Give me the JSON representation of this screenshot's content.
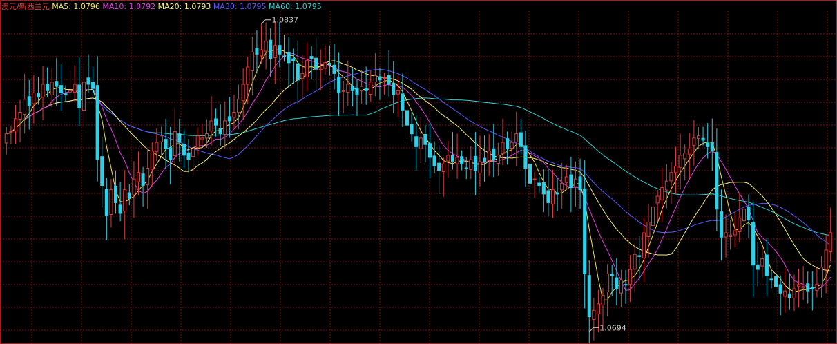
{
  "header": {
    "symbol": "澳元/新西兰元",
    "symbol_color": "#e03c3c",
    "ma_legend": [
      {
        "label": "MA5:",
        "value": "1.0796",
        "color": "#f2e64a"
      },
      {
        "label": "MA10:",
        "value": "1.0792",
        "color": "#e040e0"
      },
      {
        "label": "MA20:",
        "value": "1.0793",
        "color": "#f7f07a"
      },
      {
        "label": "MA30:",
        "value": "1.0795",
        "color": "#5a5aff"
      },
      {
        "label": "MA60:",
        "value": "1.0795",
        "color": "#2fd0d0"
      }
    ]
  },
  "chart_data": {
    "type": "candlestick",
    "ylim": [
      1.0689,
      1.0843
    ],
    "grid": true,
    "annotations": {
      "high": {
        "label": "1.0837",
        "value": 1.0837,
        "index": 56
      },
      "low": {
        "label": "1.0694",
        "value": 1.0694,
        "index": 128
      }
    },
    "colors": {
      "up": "#e03c3c",
      "down": "#2fd0e8",
      "grid": "#7a1515",
      "border": "#b01818",
      "ma5": "#f2e64a",
      "ma10": "#e040e0",
      "ma20": "#f7f07a",
      "ma30": "#5a5aff",
      "ma60": "#2fd0d0"
    },
    "closes": [
      1.0786,
      1.0787,
      1.0793,
      1.0796,
      1.0802,
      1.0799,
      1.0805,
      1.0803,
      1.0809,
      1.0806,
      1.081,
      1.0808,
      1.0805,
      1.0804,
      1.0806,
      1.0809,
      1.0798,
      1.081,
      1.0809,
      1.0807,
      1.0774,
      1.0762,
      1.0748,
      1.076,
      1.0754,
      1.0749,
      1.076,
      1.0756,
      1.0765,
      1.0768,
      1.0762,
      1.077,
      1.0778,
      1.0782,
      1.0785,
      1.0779,
      1.0774,
      1.0787,
      1.0782,
      1.0776,
      1.0774,
      1.0779,
      1.0785,
      1.0784,
      1.0786,
      1.0792,
      1.079,
      1.0786,
      1.0792,
      1.0792,
      1.0796,
      1.0802,
      1.0809,
      1.0817,
      1.0824,
      1.0823,
      1.0825,
      1.0829,
      1.0821,
      1.0827,
      1.0823,
      1.0822,
      1.0819,
      1.082,
      1.0811,
      1.0814,
      1.082,
      1.0821,
      1.0816,
      1.0816,
      1.0819,
      1.0818,
      1.0814,
      1.0805,
      1.0806,
      1.0809,
      1.0806,
      1.0804,
      1.0808,
      1.0806,
      1.081,
      1.0813,
      1.0811,
      1.0812,
      1.0809,
      1.0804,
      1.0806,
      1.0797,
      1.079,
      1.0786,
      1.078,
      1.0784,
      1.0781,
      1.0775,
      1.0771,
      1.0769,
      1.0772,
      1.0776,
      1.0773,
      1.0775,
      1.0772,
      1.077,
      1.0774,
      1.0769,
      1.0773,
      1.0773,
      1.0778,
      1.0774,
      1.0776,
      1.0782,
      1.0779,
      1.0782,
      1.0786,
      1.078,
      1.077,
      1.0763,
      1.0765,
      1.0762,
      1.0758,
      1.0754,
      1.076,
      1.0758,
      1.0763,
      1.0766,
      1.0761,
      1.0765,
      1.076,
      1.0721,
      1.0701,
      1.0704,
      1.0707,
      1.0711,
      1.0721,
      1.072,
      1.0714,
      1.0718,
      1.0716,
      1.0723,
      1.073,
      1.0729,
      1.074,
      1.0745,
      1.0752,
      1.0757,
      1.0761,
      1.0764,
      1.0768,
      1.0771,
      1.0776,
      1.0777,
      1.0779,
      1.0784,
      1.0785,
      1.0783,
      1.078,
      1.0778,
      1.0751,
      1.0738,
      1.074,
      1.0739,
      1.0741,
      1.0747,
      1.0751,
      1.0746,
      1.0725,
      1.0723,
      1.0728,
      1.072,
      1.0718,
      1.0715,
      1.0712,
      1.0713,
      1.071,
      1.0714,
      1.0716,
      1.0715,
      1.0713,
      1.0714,
      1.0716,
      1.0724,
      1.0732,
      1.074
    ]
  }
}
